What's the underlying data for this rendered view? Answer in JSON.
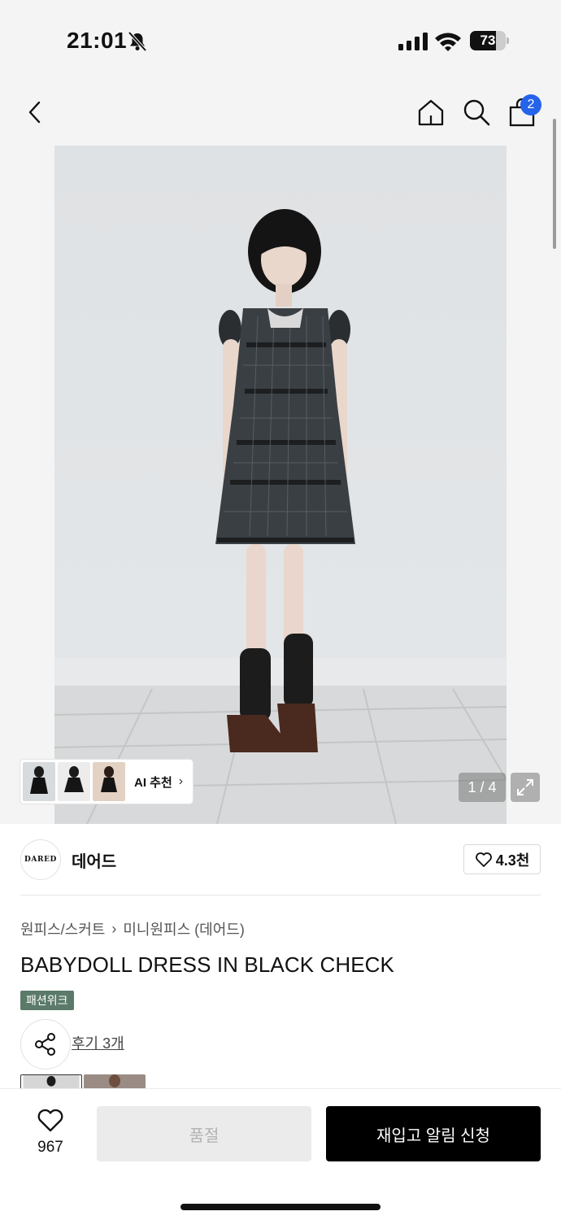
{
  "status_bar": {
    "time": "21:01",
    "battery": "73",
    "battery_level": 0.73
  },
  "nav": {
    "cart_badge": "2"
  },
  "gallery": {
    "counter": "1 / 4",
    "ai_label": "AI 추천",
    "ai_chevron": "›"
  },
  "brand": {
    "logo_text": "DARED",
    "name": "데어드",
    "likes": "4.3천"
  },
  "product": {
    "breadcrumb": [
      "원피스/스커트",
      "미니원피스 (데어드)"
    ],
    "breadcrumb_separator": "›",
    "title": "BABYDOLL DRESS IN BLACK CHECK",
    "tag": "패션위크",
    "reviews": "후기 3개"
  },
  "bottom": {
    "wish_count": "967",
    "soldout_label": "품절",
    "restock_label": "재입고 알림 신청"
  }
}
